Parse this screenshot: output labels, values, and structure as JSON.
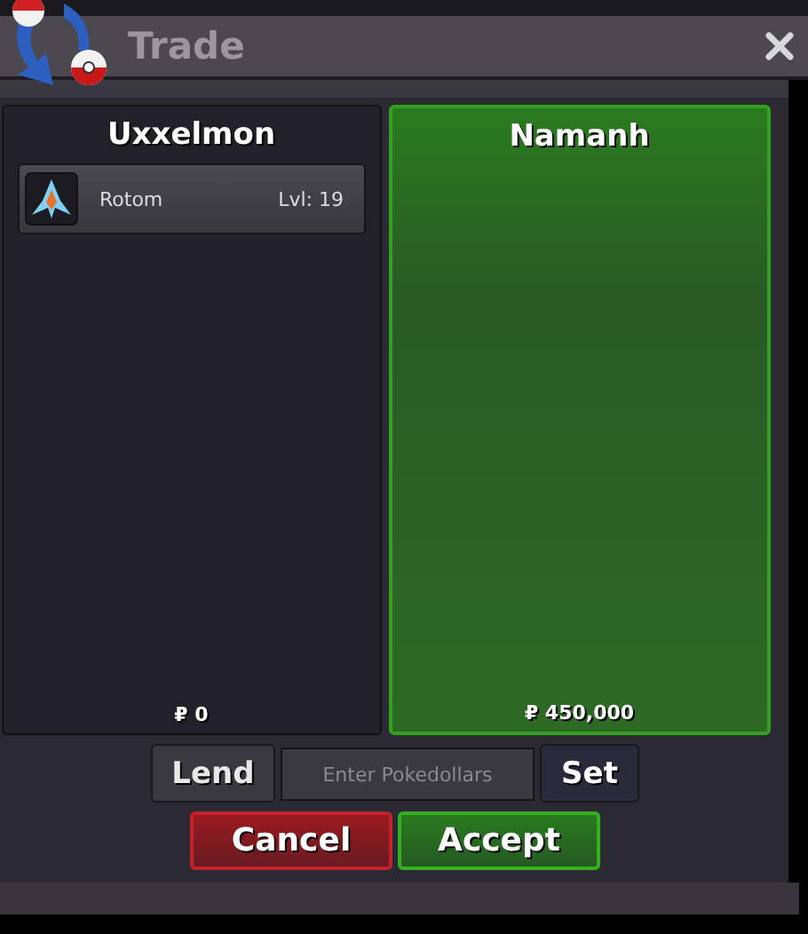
{
  "window": {
    "title": "Trade"
  },
  "traders": [
    {
      "name": "Uxxelmon",
      "accepted": false,
      "items": [
        {
          "name": "Rotom",
          "level": "Lvl: 19"
        }
      ],
      "money": "₽ 0"
    },
    {
      "name": "Namanh",
      "accepted": true,
      "money": "₽ 450,000"
    }
  ],
  "money_entry": {
    "lend_button": "Lend",
    "placeholder": "Enter Pokedollars",
    "set_button": "Set"
  },
  "buttons": [
    {
      "label": "Cancel",
      "kind": "cancel"
    },
    {
      "label": "Accept",
      "kind": "accept"
    }
  ]
}
